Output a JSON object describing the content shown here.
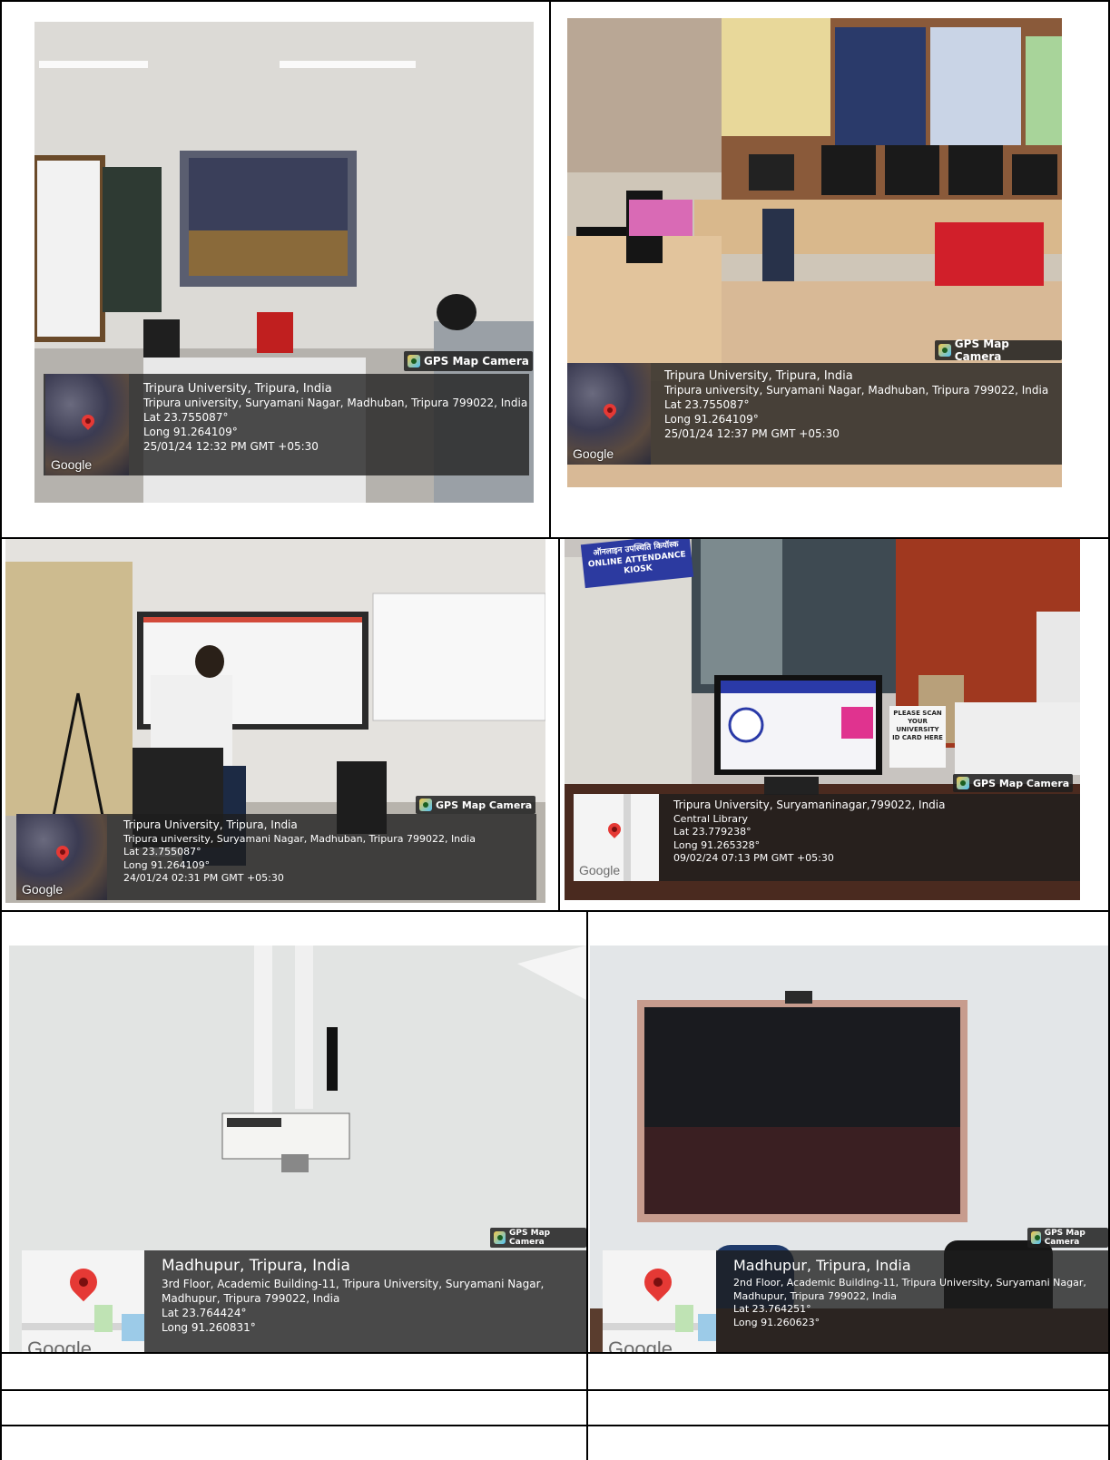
{
  "badge_label": "GPS Map Camera",
  "google_label": "Google",
  "photos": [
    {
      "title": "Tripura University, Tripura, India",
      "address": "Tripura university, Suryamani Nagar, Madhuban, Tripura 799022, India",
      "lat": "Lat 23.755087°",
      "long": "Long 91.264109°",
      "datetime": "25/01/24 12:32 PM GMT +05:30"
    },
    {
      "title": "Tripura University, Tripura, India",
      "address": "Tripura university, Suryamani Nagar, Madhuban, Tripura 799022, India",
      "lat": "Lat 23.755087°",
      "long": "Long 91.264109°",
      "datetime": "25/01/24 12:37 PM GMT +05:30"
    },
    {
      "title": "Tripura University, Tripura, India",
      "address": "Tripura university, Suryamani Nagar, Madhuban, Tripura 799022, India",
      "lat": "Lat 23.755087°",
      "long": "Long 91.264109°",
      "datetime": "24/01/24 02:31 PM GMT +05:30"
    },
    {
      "title": "Tripura University, Suryamaninagar,799022, India",
      "address": "Central Library",
      "lat": "Lat 23.779238°",
      "long": "Long 91.265328°",
      "datetime": "09/02/24 07:13 PM GMT +05:30",
      "kiosk_sign_hindi": "ऑनलाइन उपस्थिति कियॉस्क",
      "kiosk_sign": "ONLINE ATTENDANCE KIOSK",
      "scan_notice": "PLEASE SCAN YOUR UNIVERSITY ID CARD HERE"
    },
    {
      "title": "Madhupur, Tripura, India",
      "address_line1": "3rd Floor, Academic Building-11, Tripura University, Suryamani Nagar,",
      "address_line2": "Madhupur, Tripura 799022, India",
      "lat": "Lat 23.764424°",
      "long": "Long 91.260831°"
    },
    {
      "title": "Madhupur, Tripura, India",
      "address_line1": "2nd Floor, Academic Building-11, Tripura University, Suryamani Nagar,",
      "address_line2": "Madhupur, Tripura 799022, India",
      "lat": "Lat 23.764251°",
      "long": "Long 91.260623°"
    }
  ]
}
